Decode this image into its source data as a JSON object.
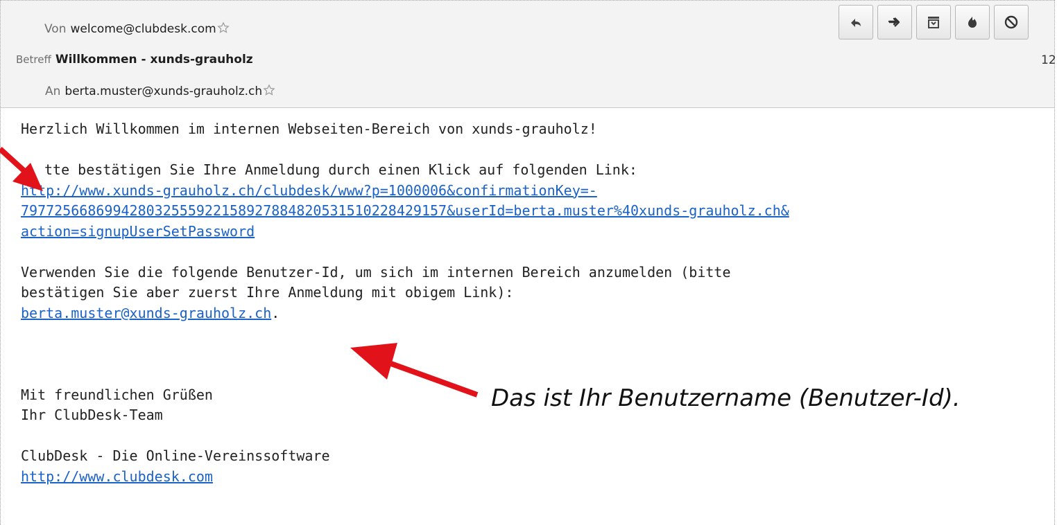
{
  "header": {
    "from_label": "Von",
    "from_value": "welcome@clubdesk.com",
    "subject_label": "Betreff",
    "subject_value": "Willkommen - xunds-grauholz",
    "to_label": "An",
    "to_value": "berta.muster@xunds-grauholz.ch",
    "date_fragment": "12"
  },
  "toolbar": {
    "buttons": [
      "reply-icon",
      "forward-icon",
      "archive-icon",
      "junk-icon",
      "block-icon"
    ]
  },
  "body": {
    "greeting": "Herzlich Willkommen im internen Webseiten-Bereich von xunds-grauholz!",
    "confirm_text": "tte bestätigen Sie Ihre Anmeldung durch einen Klick auf folgenden Link:",
    "confirm_link_1": "http://www.xunds-grauholz.ch/clubdesk/www?p=1000006&confirmationKey=-",
    "confirm_link_2": "797725668699428032555922158927884820531510228429157&userId=berta.muster%40xunds-grauholz.ch&",
    "confirm_link_3": "action=signupUserSetPassword",
    "userid_text_1": "Verwenden Sie die folgende Benutzer-Id, um sich im internen Bereich anzumelden (bitte",
    "userid_text_2": "bestätigen Sie aber zuerst Ihre Anmeldung mit obigem Link):",
    "userid_link": "berta.muster@xunds-grauholz.ch",
    "userid_period": ".",
    "closing": "Mit freundlichen Grüßen",
    "team": "Ihr ClubDesk-Team",
    "signature": "ClubDesk - Die Online-Vereinssoftware",
    "signature_link": "http://www.clubdesk.com"
  },
  "annotation": {
    "text": "Das ist Ihr Benutzername (Benutzer-Id)."
  },
  "colors": {
    "link": "#1a62c7",
    "arrow": "#e2121b",
    "header_bg": "#f3f3f3"
  }
}
